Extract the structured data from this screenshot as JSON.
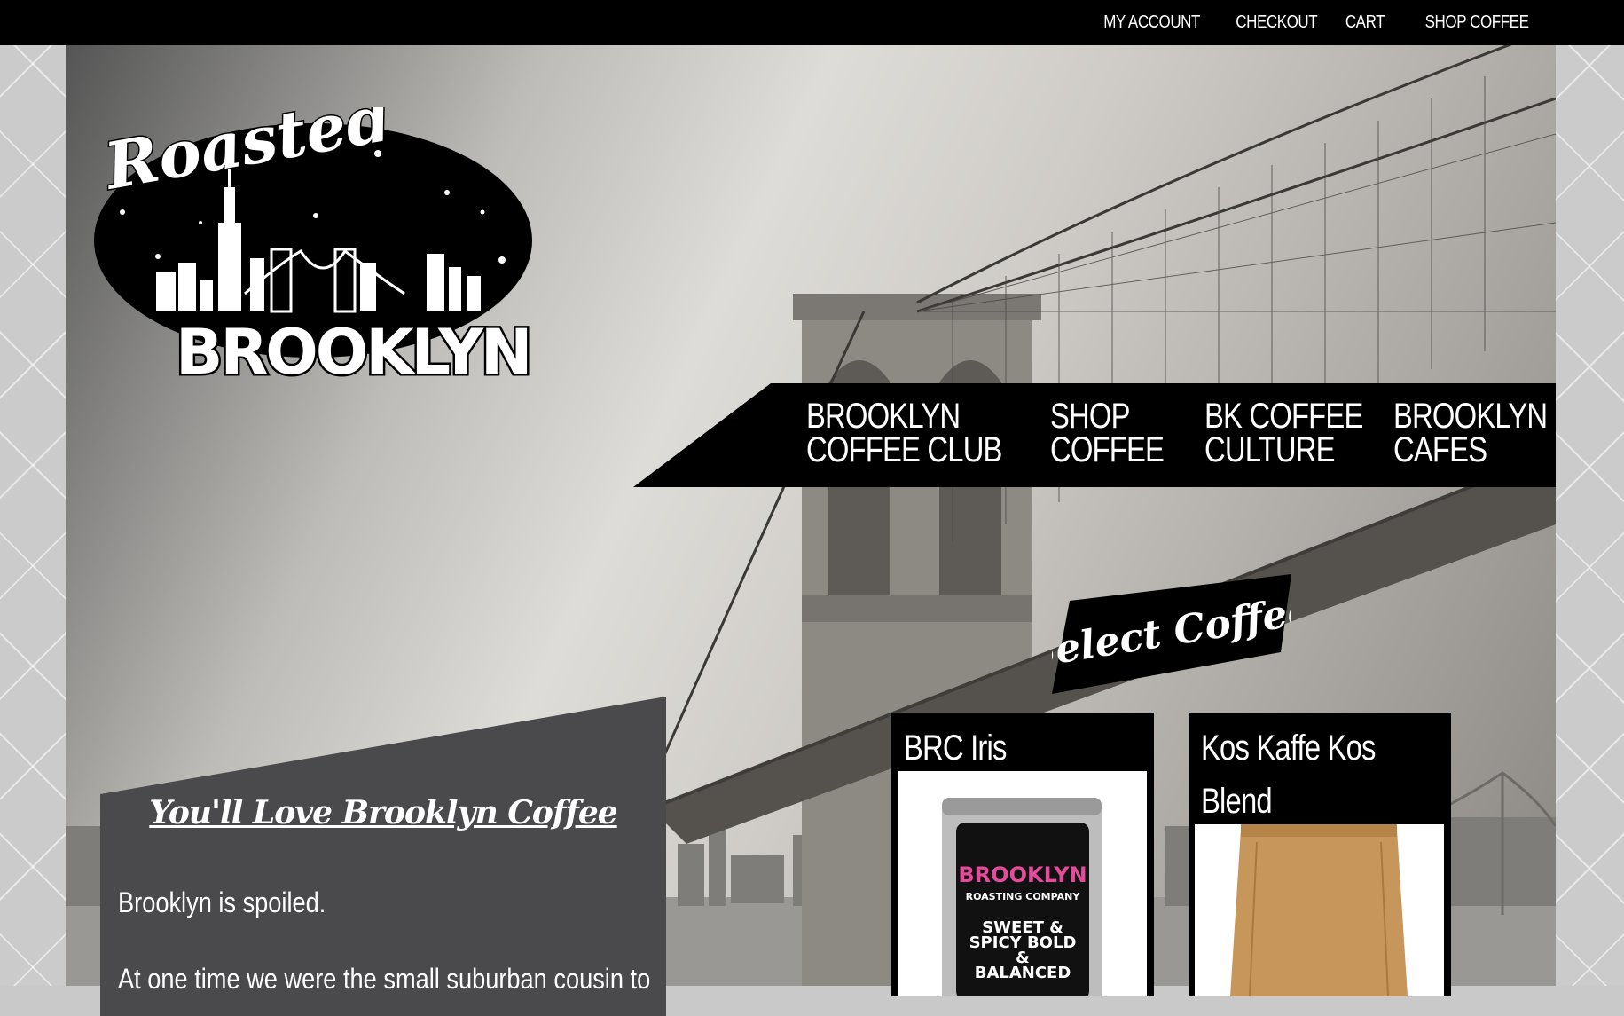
{
  "topnav": {
    "items": [
      {
        "label": "MY ACCOUNT"
      },
      {
        "label": "CHECKOUT"
      },
      {
        "label": "CART"
      },
      {
        "label": "SHOP COFFEE"
      }
    ]
  },
  "logo": {
    "script_text": "Roasted",
    "block_text": "BROOKLYN"
  },
  "mainnav": {
    "items": [
      {
        "line1": "BROOKLYN",
        "line2": "COFFEE CLUB"
      },
      {
        "line1": "SHOP",
        "line2": "COFFEE"
      },
      {
        "line1": "BK COFFEE",
        "line2": "CULTURE"
      },
      {
        "line1": "BROOKLYN",
        "line2": "CAFES"
      }
    ]
  },
  "select_banner": {
    "label": "Select Coffee"
  },
  "intro": {
    "heading": "You'll Love Brooklyn Coffee",
    "paragraph1": "Brooklyn is spoiled.",
    "paragraph2": "At one time we were the small suburban cousin to"
  },
  "products": [
    {
      "name": "BRC Iris",
      "can_brand": "BROOKLYN",
      "can_sub": "ROASTING COMPANY",
      "can_tagline": "SWEET & SPICY BOLD & BALANCED"
    },
    {
      "name_line1": "Kos Kaffe Kos",
      "name_line2": "Blend"
    }
  ],
  "colors": {
    "topbar": "#000000",
    "panel": "#4a4a4c",
    "background": "#c9c9c9",
    "bag": "#c7965a"
  }
}
